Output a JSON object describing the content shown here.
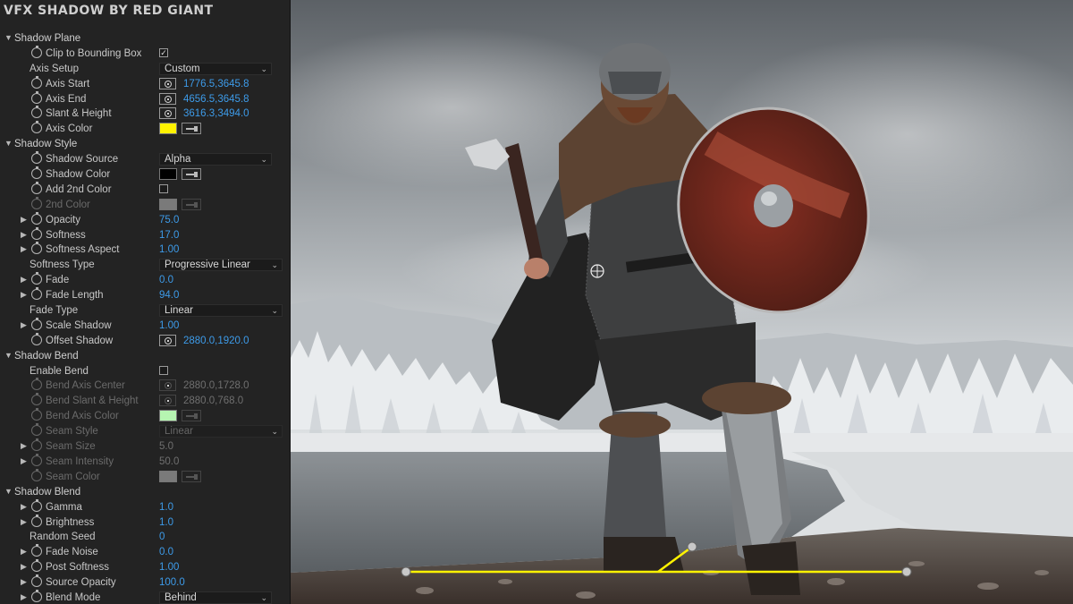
{
  "app_title": "VFX SHADOW BY RED GIANT",
  "colors": {
    "accent_blue": "#3d9be9",
    "axis_yellow": "#fff200",
    "bend_green": "#b6f5b1"
  },
  "rows": [
    {
      "type": "section",
      "label": "Shadow Plane"
    },
    {
      "type": "checkbox",
      "label": "Clip to Bounding Box",
      "checked": true,
      "sw": true,
      "mark": "✓"
    },
    {
      "type": "dropdown",
      "label": "Axis Setup",
      "value": "Custom"
    },
    {
      "type": "point",
      "label": "Axis Start",
      "value": "1776.5,3645.8",
      "sw": true
    },
    {
      "type": "point",
      "label": "Axis End",
      "value": "4656.5,3645.8",
      "sw": true
    },
    {
      "type": "point",
      "label": "Slant & Height",
      "value": "3616.3,3494.0",
      "sw": true
    },
    {
      "type": "color",
      "label": "Axis Color",
      "color": "#fff200",
      "sw": true
    },
    {
      "type": "section",
      "label": "Shadow Style"
    },
    {
      "type": "dropdown",
      "label": "Shadow Source",
      "value": "Alpha",
      "sw": true
    },
    {
      "type": "color",
      "label": "Shadow Color",
      "color": "#000000",
      "sw": true
    },
    {
      "type": "checkbox",
      "label": "Add 2nd Color",
      "checked": false,
      "sw": true,
      "mark": ""
    },
    {
      "type": "color",
      "label": "2nd Color",
      "color": "#7a7a7a",
      "sw": true,
      "disabled": true
    },
    {
      "type": "value",
      "label": "Opacity",
      "value": "75.0",
      "sw": true,
      "twirl": true
    },
    {
      "type": "value",
      "label": "Softness",
      "value": "17.0",
      "sw": true,
      "twirl": true
    },
    {
      "type": "value",
      "label": "Softness Aspect",
      "value": "1.00",
      "sw": true,
      "twirl": true
    },
    {
      "type": "dropdown",
      "label": "Softness Type",
      "value": "Progressive Linear",
      "wide": true
    },
    {
      "type": "value",
      "label": "Fade",
      "value": "0.0",
      "sw": true,
      "twirl": true
    },
    {
      "type": "value",
      "label": "Fade Length",
      "value": "94.0",
      "sw": true,
      "twirl": true
    },
    {
      "type": "dropdown",
      "label": "Fade Type",
      "value": "Linear",
      "wide": true
    },
    {
      "type": "value",
      "label": "Scale Shadow",
      "value": "1.00",
      "sw": true,
      "twirl": true
    },
    {
      "type": "point",
      "label": "Offset Shadow",
      "value": "2880.0,1920.0",
      "sw": true
    },
    {
      "type": "section",
      "label": "Shadow Bend"
    },
    {
      "type": "checkbox",
      "label": "Enable Bend",
      "checked": false,
      "mark": ""
    },
    {
      "type": "point",
      "label": "Bend Axis Center",
      "value": "2880.0,1728.0",
      "sw": true,
      "disabled": true
    },
    {
      "type": "point",
      "label": "Bend Slant & Height",
      "value": "2880.0,768.0",
      "sw": true,
      "disabled": true
    },
    {
      "type": "color",
      "label": "Bend Axis Color",
      "color": "#b6f5b1",
      "sw": true,
      "disabled": true
    },
    {
      "type": "dropdown",
      "label": "Seam Style",
      "value": "Linear",
      "sw": true,
      "disabled": true,
      "wide": true
    },
    {
      "type": "value",
      "label": "Seam Size",
      "value": "5.0",
      "sw": true,
      "twirl": true,
      "disabled": true
    },
    {
      "type": "value",
      "label": "Seam Intensity",
      "value": "50.0",
      "sw": true,
      "twirl": true,
      "disabled": true
    },
    {
      "type": "color",
      "label": "Seam Color",
      "color": "#7a7a7a",
      "sw": true,
      "disabled": true
    },
    {
      "type": "section",
      "label": "Shadow Blend"
    },
    {
      "type": "value",
      "label": "Gamma",
      "value": "1.0",
      "sw": true,
      "twirl": true
    },
    {
      "type": "value",
      "label": "Brightness",
      "value": "1.0",
      "sw": true,
      "twirl": true
    },
    {
      "type": "value",
      "label": "Random Seed",
      "value": "0"
    },
    {
      "type": "value",
      "label": "Fade Noise",
      "value": "0.0",
      "sw": true,
      "twirl": true
    },
    {
      "type": "value",
      "label": "Post Softness",
      "value": "1.00",
      "sw": true,
      "twirl": true
    },
    {
      "type": "value",
      "label": "Source Opacity",
      "value": "100.0",
      "sw": true,
      "twirl": true
    },
    {
      "type": "dropdown",
      "label": "Blend Mode",
      "value": "Behind",
      "sw": true,
      "twirl": true
    }
  ]
}
